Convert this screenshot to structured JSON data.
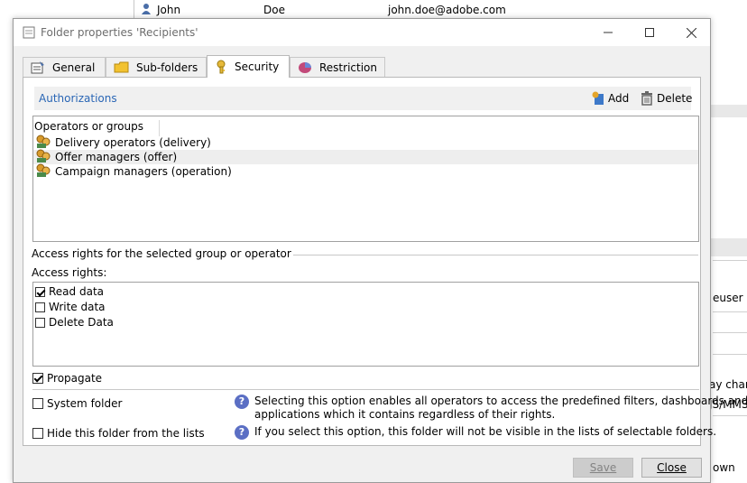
{
  "background": {
    "row": {
      "first_name": "John",
      "last_name": "Doe",
      "email": "john.doe@adobe.com"
    },
    "fragments": [
      "euser",
      "ay chann",
      "JS/MMS",
      "own"
    ]
  },
  "dialog": {
    "title": "Folder properties 'Recipients'",
    "tabs": [
      "General",
      "Sub-folders",
      "Security",
      "Restriction"
    ],
    "active_tab": "Security",
    "authorizations": {
      "title": "Authorizations",
      "add_label": "Add",
      "delete_label": "Delete",
      "column_header": "Operators or groups",
      "groups": [
        {
          "label": "Delivery operators (delivery)",
          "selected": false
        },
        {
          "label": "Offer managers (offer)",
          "selected": true
        },
        {
          "label": "Campaign managers (operation)",
          "selected": false
        }
      ]
    },
    "access": {
      "group_title": "Access rights for the selected group or operator",
      "rights_label": "Access rights:",
      "rights": [
        {
          "label": "Read data",
          "checked": true
        },
        {
          "label": "Write data",
          "checked": false
        },
        {
          "label": "Delete Data",
          "checked": false
        }
      ],
      "propagate_label": "Propagate",
      "propagate_checked": true
    },
    "options": {
      "system_folder_label": "System folder",
      "system_folder_checked": false,
      "system_folder_help_line1": "Selecting this option enables all operators to access the predefined filters, dashboards and web",
      "system_folder_help_line2": "applications which it contains regardless of their rights.",
      "hide_label": "Hide this folder from the lists",
      "hide_checked": false,
      "hide_help": "If you select this option, this folder will not be visible in the lists of selectable folders."
    },
    "buttons": {
      "save_label": "Save",
      "save_enabled": false,
      "close_label": "Close"
    }
  },
  "colors": {
    "accent": "#2a66b5",
    "help_icon": "#5b6fc4"
  }
}
